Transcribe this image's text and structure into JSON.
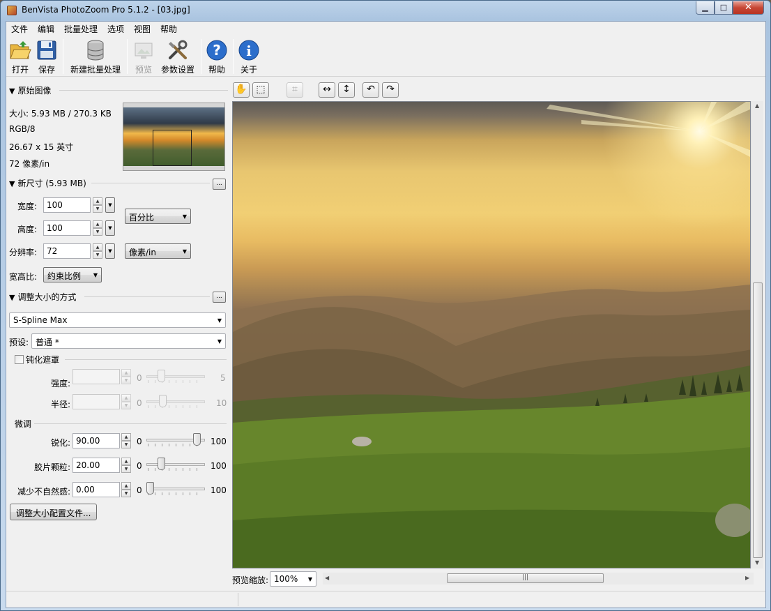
{
  "window": {
    "title": "BenVista PhotoZoom Pro 5.1.2 - [03.jpg]",
    "minimize": "▁",
    "maximize": "□",
    "close": "✕"
  },
  "menu": [
    "文件",
    "编辑",
    "批量处理",
    "选项",
    "视图",
    "帮助"
  ],
  "toolbar": {
    "open": "打开",
    "save": "保存",
    "new_batch": "新建批量处理",
    "preview": "预览",
    "settings": "参数设置",
    "help": "帮助",
    "about": "关于"
  },
  "original": {
    "header": "原始图像",
    "size": "大小: 5.93 MB / 270.3 KB",
    "mode": "RGB/8",
    "dimensions": "26.67 x 15 英寸",
    "resolution": "72 像素/in"
  },
  "new_size": {
    "header": "新尺寸 (5.93 MB)",
    "more": "...",
    "width_label": "宽度:",
    "width_value": "100",
    "height_label": "高度:",
    "height_value": "100",
    "resolution_label": "分辨率:",
    "resolution_value": "72",
    "unit_size": "百分比",
    "unit_resolution": "像素/in",
    "aspect_label": "宽高比:",
    "aspect_value": "约束比例"
  },
  "method": {
    "header": "调整大小的方式",
    "more": "...",
    "algorithm": "S-Spline Max",
    "preset_label": "预设:",
    "preset_value": "普通 *"
  },
  "unsharp": {
    "label": "钝化遮罩",
    "strength_label": "强度:",
    "strength_min": "0",
    "strength_max": "5",
    "radius_label": "半径:",
    "radius_min": "0",
    "radius_max": "10"
  },
  "finetune": {
    "header": "微调",
    "sharpen_label": "锐化:",
    "sharpen_value": "90.00",
    "sharpen_min": "0",
    "sharpen_max": "100",
    "grain_label": "胶片颗粒:",
    "grain_value": "20.00",
    "grain_min": "0",
    "grain_max": "100",
    "artifact_label": "减少不自然感:",
    "artifact_value": "0.00",
    "artifact_min": "0",
    "artifact_max": "100"
  },
  "profile_button": "调整大小配置文件...",
  "preview_zoom": {
    "label": "预览缩放:",
    "value": "100%"
  },
  "scroll_grip": "|||"
}
